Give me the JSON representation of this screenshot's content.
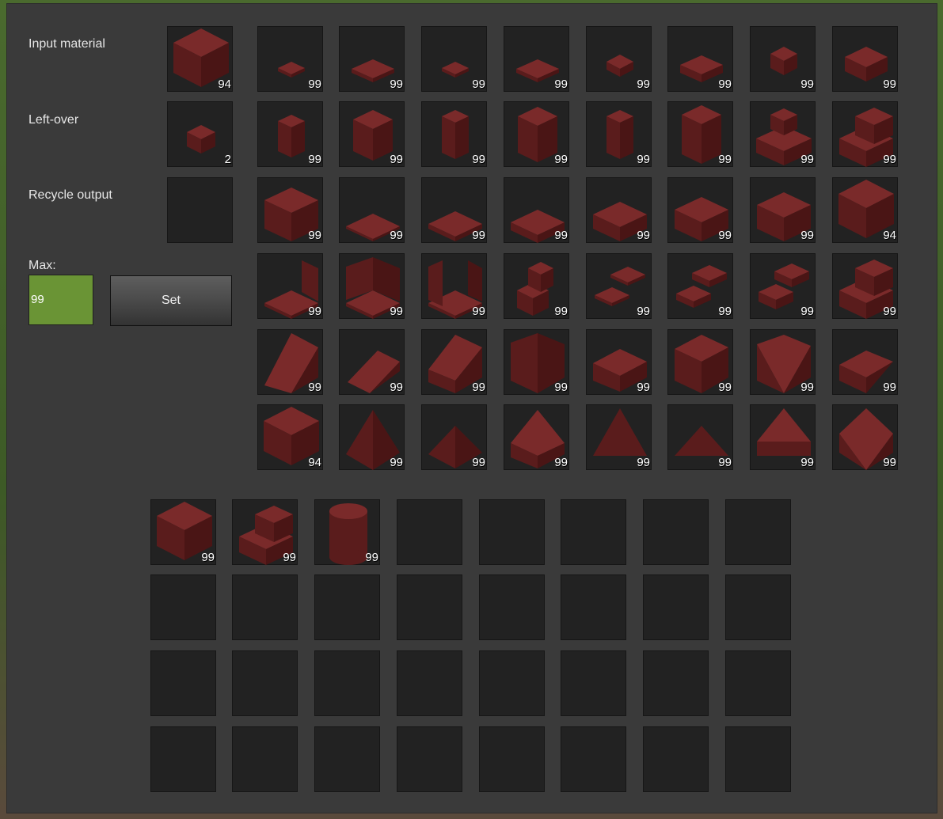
{
  "labels": {
    "input_material": "Input material",
    "leftover": "Left-over",
    "recycle_output": "Recycle output",
    "max": "Max:"
  },
  "max_input": {
    "value": "99"
  },
  "set_button": {
    "label": "Set"
  },
  "colors": {
    "block_top": "#7a2a2a",
    "block_left": "#5a1c1c",
    "block_right": "#4a1515"
  },
  "input_slot": {
    "item": "red-cube",
    "count": "94"
  },
  "leftover_slot": {
    "item": "red-small-cube",
    "count": "2"
  },
  "recycle_slot": {
    "item": "",
    "count": ""
  },
  "output_grid": [
    [
      {
        "item": "micro-slab",
        "count": "99"
      },
      {
        "item": "long-thin-plate",
        "count": "99"
      },
      {
        "item": "small-tile",
        "count": "99"
      },
      {
        "item": "long-tile",
        "count": "99"
      },
      {
        "item": "small-block",
        "count": "99"
      },
      {
        "item": "wide-slab",
        "count": "99"
      },
      {
        "item": "small-cube",
        "count": "99"
      },
      {
        "item": "half-slab",
        "count": "99"
      }
    ],
    [
      {
        "item": "thin-pillar",
        "count": "99"
      },
      {
        "item": "half-pillar",
        "count": "99"
      },
      {
        "item": "tall-thin-pillar",
        "count": "99"
      },
      {
        "item": "tall-half-pillar",
        "count": "99"
      },
      {
        "item": "tall-pillar",
        "count": "99"
      },
      {
        "item": "tall-wide-pillar",
        "count": "99"
      },
      {
        "item": "stair-corner",
        "count": "99"
      },
      {
        "item": "stair",
        "count": "99"
      }
    ],
    [
      {
        "item": "inner-stair",
        "count": "99"
      },
      {
        "item": "thin-plate",
        "count": "99"
      },
      {
        "item": "plate",
        "count": "99"
      },
      {
        "item": "thick-plate",
        "count": "99"
      },
      {
        "item": "slab",
        "count": "99"
      },
      {
        "item": "thick-slab",
        "count": "99"
      },
      {
        "item": "big-slab",
        "count": "99"
      },
      {
        "item": "full-cube",
        "count": "94"
      }
    ],
    [
      {
        "item": "corner-wall",
        "count": "99"
      },
      {
        "item": "double-wall",
        "count": "99"
      },
      {
        "item": "u-wall",
        "count": "99"
      },
      {
        "item": "step",
        "count": "99"
      },
      {
        "item": "two-plates",
        "count": "99"
      },
      {
        "item": "two-slabs",
        "count": "99"
      },
      {
        "item": "two-thick-slabs",
        "count": "99"
      },
      {
        "item": "stair-alt",
        "count": "99"
      }
    ],
    [
      {
        "item": "slope-steep",
        "count": "99"
      },
      {
        "item": "slope-low",
        "count": "99"
      },
      {
        "item": "slope",
        "count": "99"
      },
      {
        "item": "slope-corner",
        "count": "99"
      },
      {
        "item": "slope-half",
        "count": "99"
      },
      {
        "item": "slope-inner",
        "count": "99"
      },
      {
        "item": "slope-outer",
        "count": "99"
      },
      {
        "item": "slope-flat",
        "count": "99"
      }
    ],
    [
      {
        "item": "slope-cube",
        "count": "94"
      },
      {
        "item": "pyramid",
        "count": "99"
      },
      {
        "item": "low-pyramid",
        "count": "99"
      },
      {
        "item": "pyramid-block",
        "count": "99"
      },
      {
        "item": "triangle",
        "count": "99"
      },
      {
        "item": "small-triangle",
        "count": "99"
      },
      {
        "item": "spike",
        "count": "99"
      },
      {
        "item": "diamond",
        "count": "99"
      }
    ]
  ],
  "inventory": [
    [
      {
        "item": "full-cube",
        "count": "99"
      },
      {
        "item": "stair",
        "count": "99"
      },
      {
        "item": "cylinder",
        "count": "99"
      },
      {
        "item": "",
        "count": ""
      },
      {
        "item": "",
        "count": ""
      },
      {
        "item": "",
        "count": ""
      },
      {
        "item": "",
        "count": ""
      },
      {
        "item": "",
        "count": ""
      }
    ],
    [
      {
        "item": "",
        "count": ""
      },
      {
        "item": "",
        "count": ""
      },
      {
        "item": "",
        "count": ""
      },
      {
        "item": "",
        "count": ""
      },
      {
        "item": "",
        "count": ""
      },
      {
        "item": "",
        "count": ""
      },
      {
        "item": "",
        "count": ""
      },
      {
        "item": "",
        "count": ""
      }
    ],
    [
      {
        "item": "",
        "count": ""
      },
      {
        "item": "",
        "count": ""
      },
      {
        "item": "",
        "count": ""
      },
      {
        "item": "",
        "count": ""
      },
      {
        "item": "",
        "count": ""
      },
      {
        "item": "",
        "count": ""
      },
      {
        "item": "",
        "count": ""
      },
      {
        "item": "",
        "count": ""
      }
    ],
    [
      {
        "item": "",
        "count": ""
      },
      {
        "item": "",
        "count": ""
      },
      {
        "item": "",
        "count": ""
      },
      {
        "item": "",
        "count": ""
      },
      {
        "item": "",
        "count": ""
      },
      {
        "item": "",
        "count": ""
      },
      {
        "item": "",
        "count": ""
      },
      {
        "item": "",
        "count": ""
      }
    ]
  ]
}
